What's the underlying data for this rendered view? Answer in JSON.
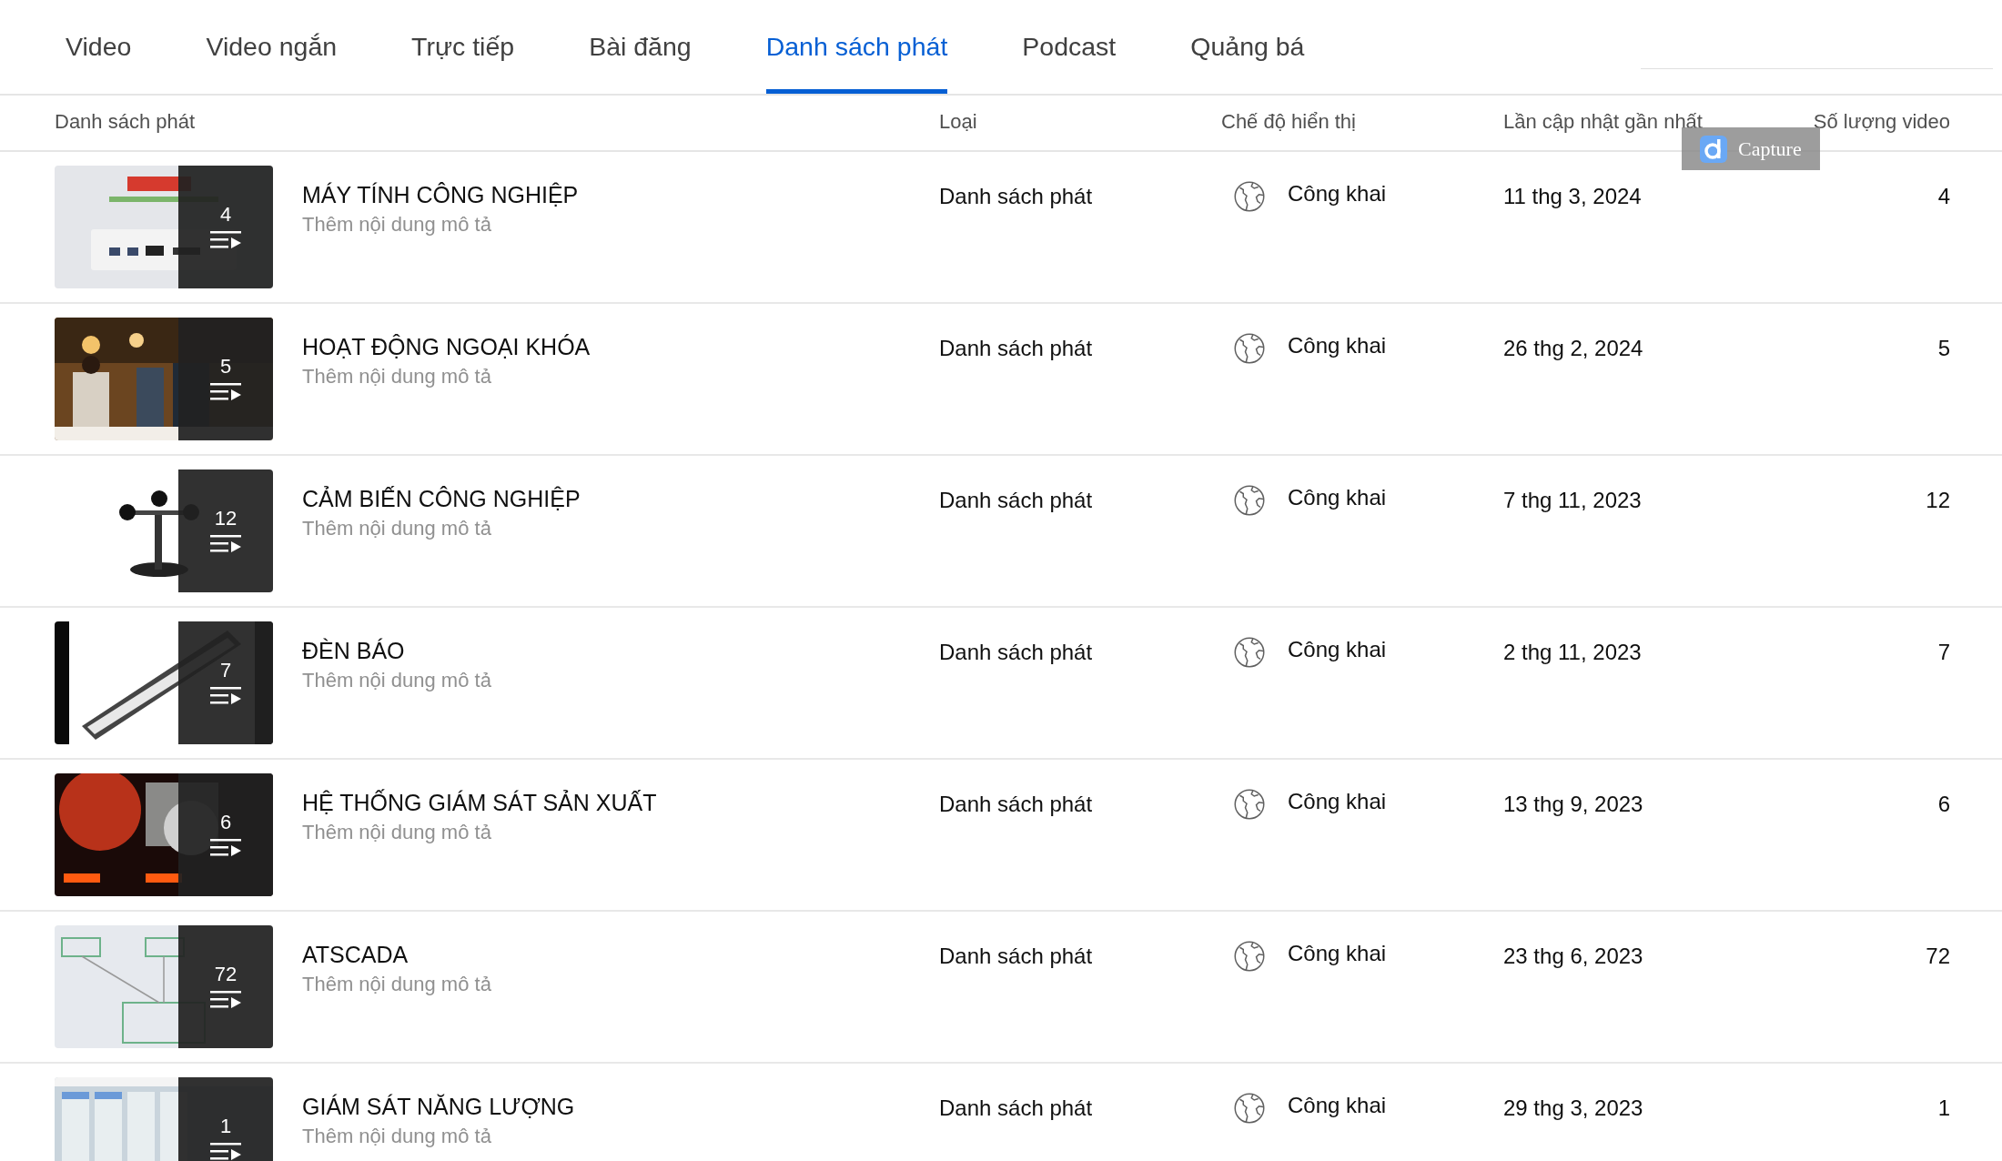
{
  "tabs": [
    {
      "label": "Video",
      "selected": false
    },
    {
      "label": "Video ngắn",
      "selected": false
    },
    {
      "label": "Trực tiếp",
      "selected": false
    },
    {
      "label": "Bài đăng",
      "selected": false
    },
    {
      "label": "Danh sách phát",
      "selected": true
    },
    {
      "label": "Podcast",
      "selected": false
    },
    {
      "label": "Quảng bá",
      "selected": false
    }
  ],
  "table": {
    "columns": [
      "Danh sách phát",
      "Loại",
      "Chế độ hiển thị",
      "Lần cập nhật gần nhất",
      "Số lượng video"
    ],
    "rows": [
      {
        "thumbnail": {
          "kind": "picture",
          "count": "4"
        },
        "title": "MÁY TÍNH CÔNG NGHIỆP",
        "description": "Thêm nội dung mô tả",
        "type": "Danh sách phát",
        "visibility": "Công khai",
        "updated": "11 thg 3, 2024",
        "video_count": "4"
      },
      {
        "thumbnail": {
          "kind": "picture",
          "count": "5"
        },
        "title": "HOẠT ĐỘNG NGOẠI KHÓA",
        "description": "Thêm nội dung mô tả",
        "type": "Danh sách phát",
        "visibility": "Công khai",
        "updated": "26 thg 2, 2024",
        "video_count": "5"
      },
      {
        "thumbnail": {
          "kind": "picture",
          "count": "12"
        },
        "title": "CẢM BIẾN CÔNG NGHIỆP",
        "description": "Thêm nội dung mô tả",
        "type": "Danh sách phát",
        "visibility": "Công khai",
        "updated": "7 thg 11, 2023",
        "video_count": "12"
      },
      {
        "thumbnail": {
          "kind": "picture",
          "count": "7"
        },
        "title": "ĐÈN BÁO",
        "description": "Thêm nội dung mô tả",
        "type": "Danh sách phát",
        "visibility": "Công khai",
        "updated": "2 thg 11, 2023",
        "video_count": "7"
      },
      {
        "thumbnail": {
          "kind": "picture",
          "count": "6"
        },
        "title": "HỆ THỐNG GIÁM SÁT SẢN XUẤT",
        "description": "Thêm nội dung mô tả",
        "type": "Danh sách phát",
        "visibility": "Công khai",
        "updated": "13 thg 9, 2023",
        "video_count": "6"
      },
      {
        "thumbnail": {
          "kind": "picture",
          "count": "72"
        },
        "title": "ATSCADA",
        "description": "Thêm nội dung mô tả",
        "type": "Danh sách phát",
        "visibility": "Công khai",
        "updated": "23 thg 6, 2023",
        "video_count": "72"
      },
      {
        "thumbnail": {
          "kind": "picture",
          "count": "1"
        },
        "title": "GIÁM SÁT NĂNG LƯỢNG",
        "description": "Thêm nội dung mô tả",
        "type": "Danh sách phát",
        "visibility": "Công khai",
        "updated": "29 thg 3, 2023",
        "video_count": "1"
      }
    ]
  },
  "capture_button": {
    "label": "Capture"
  }
}
